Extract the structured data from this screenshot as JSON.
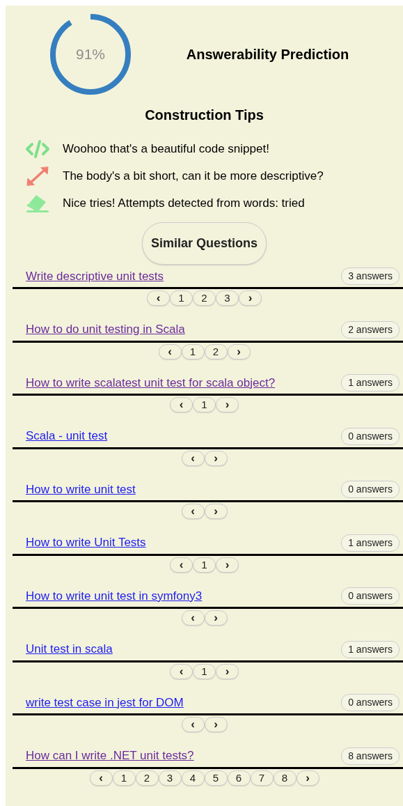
{
  "prediction": {
    "level": 0.91,
    "reading": "91%",
    "title": "Answerability Prediction"
  },
  "tips_title": "Construction Tips",
  "tips": [
    {
      "kind": "code",
      "text": "Woohoo that's a beautiful code snippet!"
    },
    {
      "kind": "expand",
      "text": "The body's a bit short, can it be more descriptive?"
    },
    {
      "kind": "eraser",
      "text": "Nice tries! Attempts detected from words: tried"
    }
  ],
  "similar_button": "Similar Questions",
  "questions": [
    {
      "title": "Write descriptive unit tests",
      "visited": true,
      "answers": "3 answers",
      "prev": "‹",
      "next": "›",
      "pages": [
        "1",
        "2",
        "3"
      ]
    },
    {
      "title": "How to do unit testing in Scala",
      "visited": true,
      "answers": "2 answers",
      "prev": "‹",
      "next": "›",
      "pages": [
        "1",
        "2"
      ]
    },
    {
      "title": "How to write scalatest unit test for scala object?",
      "visited": true,
      "answers": "1 answers",
      "prev": "‹",
      "next": "›",
      "pages": [
        "1"
      ]
    },
    {
      "title": "Scala - unit test",
      "visited": false,
      "answers": "0 answers",
      "prev": "‹",
      "next": "›"
    },
    {
      "title": "How to write unit test",
      "visited": false,
      "answers": "0 answers",
      "prev": "‹",
      "next": "›"
    },
    {
      "title": "How to write Unit Tests",
      "visited": false,
      "answers": "1 answers",
      "prev": "‹",
      "next": "›",
      "pages": [
        "1"
      ]
    },
    {
      "title": "How to write unit test in symfony3",
      "visited": false,
      "answers": "0 answers",
      "prev": "‹",
      "next": "›"
    },
    {
      "title": "Unit test in scala",
      "visited": false,
      "answers": "1 answers",
      "prev": "‹",
      "next": "›",
      "pages": [
        "1"
      ]
    },
    {
      "title": "write test case in jest for DOM",
      "visited": false,
      "answers": "0 answers",
      "prev": "‹",
      "next": "›"
    },
    {
      "title": "How can I write .NET unit tests?",
      "visited": true,
      "answers": "8 answers",
      "prev": "‹",
      "next": "›",
      "pages": [
        "1",
        "2",
        "3",
        "4",
        "5",
        "6",
        "7",
        "8"
      ]
    }
  ]
}
